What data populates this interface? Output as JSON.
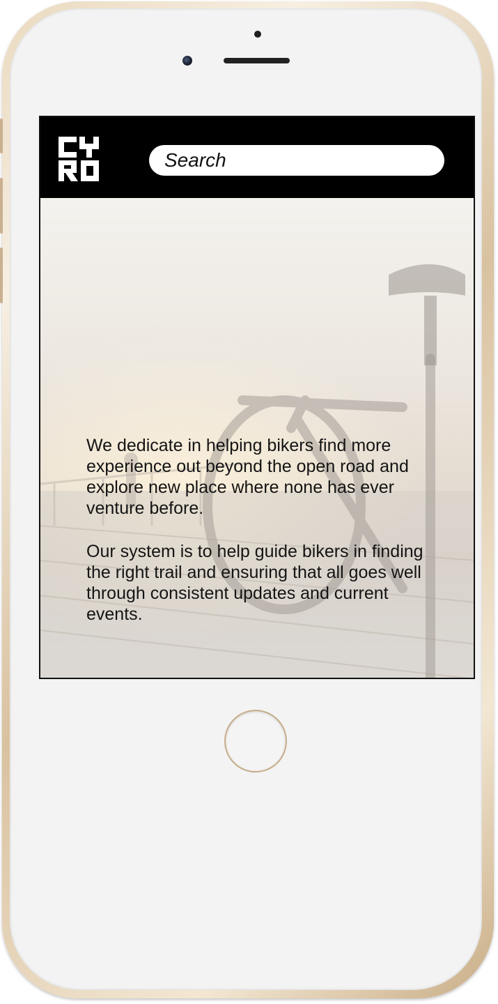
{
  "header": {
    "logo_text": "CYRO",
    "search": {
      "placeholder": "Search"
    }
  },
  "content": {
    "paragraphs": [
      "We dedicate in helping bikers find more experience out beyond the open road and explore new place where none has ever venture before.",
      "Our system is to help guide bikers in finding the right trail and ensuring that all goes well through consistent updates and current events."
    ]
  },
  "colors": {
    "header_background": "#000000",
    "search_background": "#ffffff",
    "text": "#141414",
    "frame_gold": "#d9c2a0"
  },
  "icons": {
    "logo": "cyro-logo",
    "home_button": "home-button-icon"
  }
}
